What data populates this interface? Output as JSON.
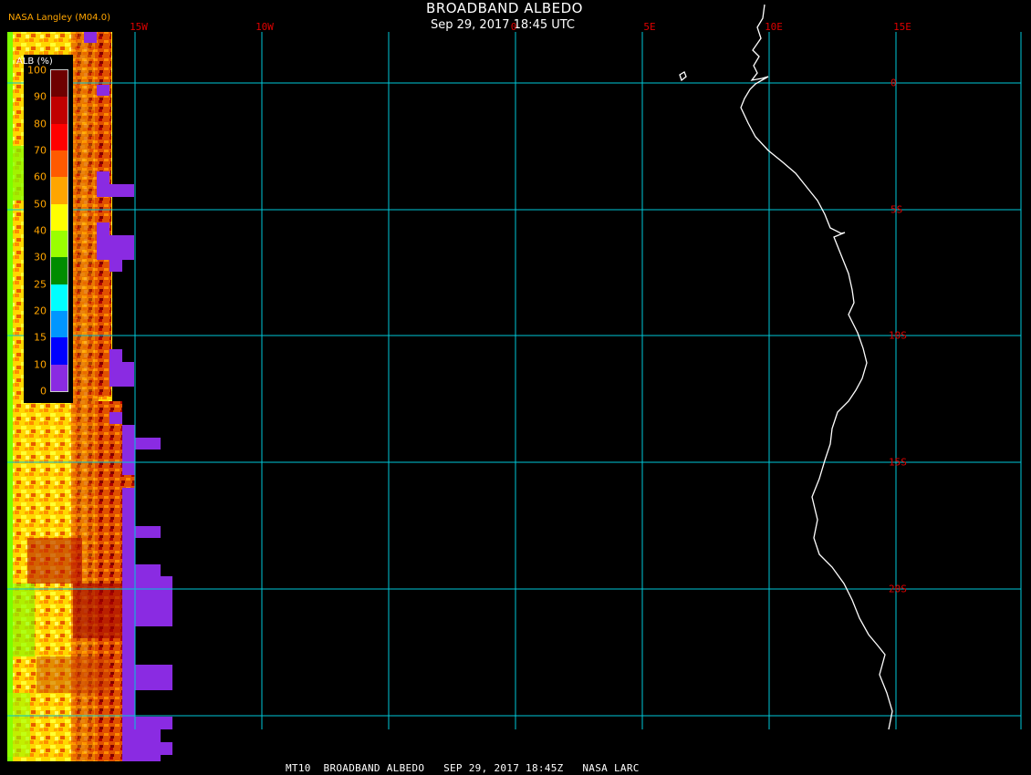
{
  "title": "BROADBAND ALBEDO",
  "subtitle": "Sep 29, 2017 18:45 UTC",
  "credit": "NASA Langley (M04.0)",
  "footer": "MT10  BROADBAND ALBEDO   SEP 29, 2017 18:45Z   NASA LARC",
  "longitude_labels": [
    "15W",
    "10W",
    "0",
    "5E",
    "10E",
    "15E"
  ],
  "latitude_labels": [
    "0",
    "5S",
    "10S",
    "15S",
    "20S"
  ],
  "legend": {
    "title": "ALB (%)",
    "ticks": [
      "100",
      "90",
      "80",
      "70",
      "60",
      "50",
      "40",
      "30",
      "25",
      "20",
      "15",
      "10",
      "0"
    ],
    "colors": [
      "#6e0000",
      "#c00000",
      "#ff0000",
      "#ff5a00",
      "#ffa500",
      "#ffff00",
      "#9aff00",
      "#008c00",
      "#00ffff",
      "#0096ff",
      "#0000ff",
      "#8a2be2"
    ]
  },
  "colors": {
    "grid": "#00c8d8",
    "coastline": "#ffffff",
    "label": "#dd0000",
    "no_data": "#8a2be2"
  }
}
